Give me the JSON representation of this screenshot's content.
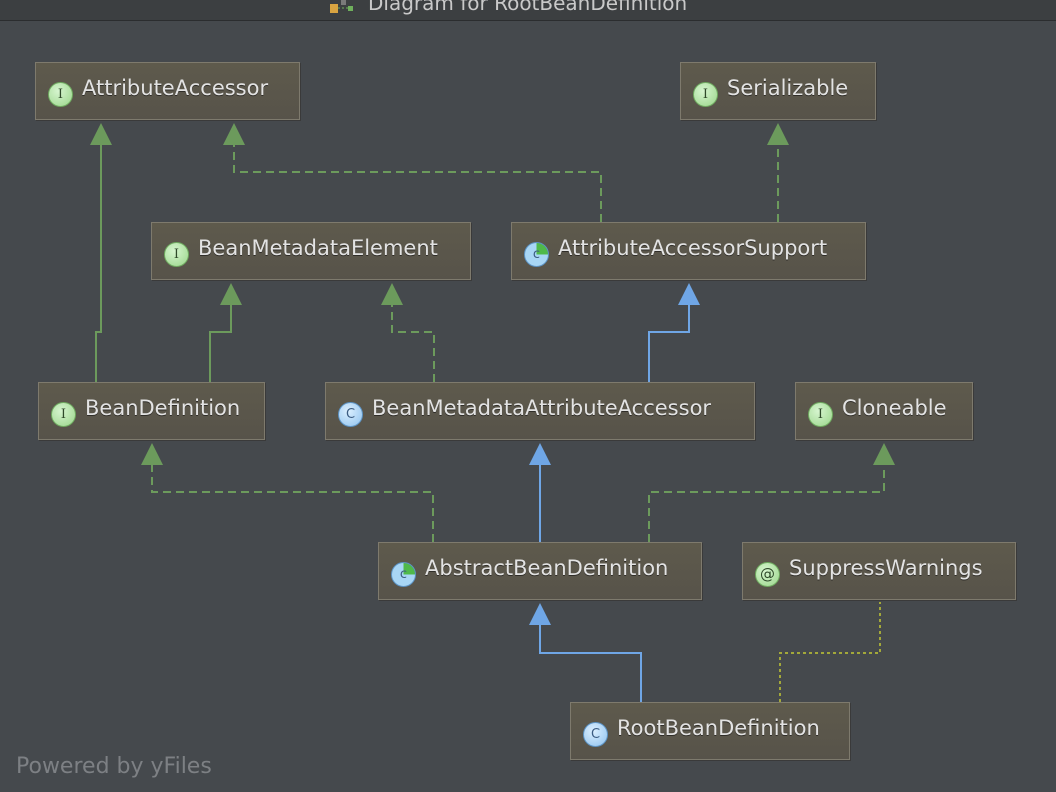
{
  "window": {
    "title": "Diagram for RootBeanDefinition",
    "title_icon": "diagram-icon"
  },
  "nodes": {
    "attribute_accessor": {
      "label": "AttributeAccessor",
      "kind": "interface",
      "badge": "I"
    },
    "serializable": {
      "label": "Serializable",
      "kind": "interface",
      "badge": "I"
    },
    "bean_metadata_element": {
      "label": "BeanMetadataElement",
      "kind": "interface",
      "badge": "I"
    },
    "attribute_accessor_support": {
      "label": "AttributeAccessorSupport",
      "kind": "abstract-class",
      "badge": "c"
    },
    "bean_definition": {
      "label": "BeanDefinition",
      "kind": "interface",
      "badge": "I"
    },
    "bean_metadata_attribute_accessor": {
      "label": "BeanMetadataAttributeAccessor",
      "kind": "class",
      "badge": "C"
    },
    "cloneable": {
      "label": "Cloneable",
      "kind": "interface",
      "badge": "I"
    },
    "abstract_bean_definition": {
      "label": "AbstractBeanDefinition",
      "kind": "abstract-class",
      "badge": "c"
    },
    "suppress_warnings": {
      "label": "SuppressWarnings",
      "kind": "annotation",
      "badge": "@"
    },
    "root_bean_definition": {
      "label": "RootBeanDefinition",
      "kind": "class",
      "badge": "C"
    }
  },
  "edges": [
    {
      "from": "bean_definition",
      "to": "attribute_accessor",
      "type": "interface-extends"
    },
    {
      "from": "bean_definition",
      "to": "bean_metadata_element",
      "type": "interface-extends"
    },
    {
      "from": "attribute_accessor_support",
      "to": "attribute_accessor",
      "type": "implements"
    },
    {
      "from": "attribute_accessor_support",
      "to": "serializable",
      "type": "implements"
    },
    {
      "from": "bean_metadata_attribute_accessor",
      "to": "bean_metadata_element",
      "type": "implements"
    },
    {
      "from": "bean_metadata_attribute_accessor",
      "to": "attribute_accessor_support",
      "type": "extends"
    },
    {
      "from": "abstract_bean_definition",
      "to": "bean_definition",
      "type": "implements"
    },
    {
      "from": "abstract_bean_definition",
      "to": "bean_metadata_attribute_accessor",
      "type": "extends"
    },
    {
      "from": "abstract_bean_definition",
      "to": "cloneable",
      "type": "implements"
    },
    {
      "from": "root_bean_definition",
      "to": "abstract_bean_definition",
      "type": "extends"
    },
    {
      "from": "root_bean_definition",
      "to": "suppress_warnings",
      "type": "annotated-with"
    }
  ],
  "colors": {
    "background": "#45494d",
    "node_fill": "#5b5749",
    "interface_edge": "#6c9a5c",
    "extends_edge": "#6fa6e6",
    "annotation_edge": "#a3a83a"
  },
  "footer": {
    "text": "Powered by yFiles"
  }
}
